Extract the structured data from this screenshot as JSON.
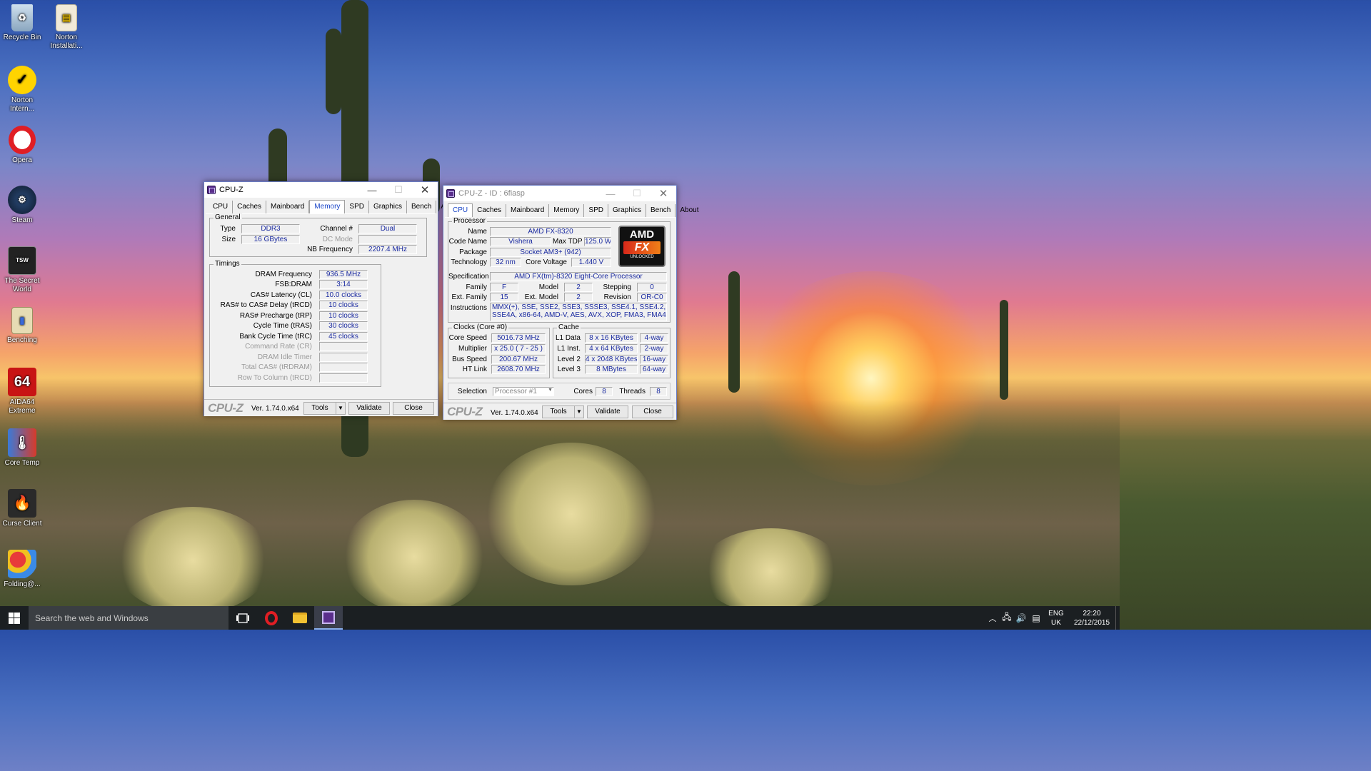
{
  "desktop": {
    "icons": [
      {
        "label": "Recycle Bin",
        "icon": "recycle-bin-icon"
      },
      {
        "label": "Norton Installati...",
        "icon": "folder-icon"
      },
      {
        "label": "Norton Intern...",
        "icon": "norton-icon"
      },
      {
        "label": "Opera",
        "icon": "opera-icon"
      },
      {
        "label": "Steam",
        "icon": "steam-icon"
      },
      {
        "label": "The Secret World",
        "icon": "secret-world-icon"
      },
      {
        "label": "Benching",
        "icon": "benching-icon"
      },
      {
        "label": "AIDA64 Extreme",
        "icon": "aida64-icon",
        "badge": "64"
      },
      {
        "label": "Core Temp",
        "icon": "core-temp-icon"
      },
      {
        "label": "Curse Client",
        "icon": "curse-client-icon"
      },
      {
        "label": "Folding@...",
        "icon": "folding-icon"
      }
    ]
  },
  "memory_window": {
    "title": "CPU-Z",
    "tabs": [
      "CPU",
      "Caches",
      "Mainboard",
      "Memory",
      "SPD",
      "Graphics",
      "Bench",
      "About"
    ],
    "selected_tab": "Memory",
    "general": {
      "group_label": "General",
      "type_label": "Type",
      "type": "DDR3",
      "size_label": "Size",
      "size": "16 GBytes",
      "channel_label": "Channel #",
      "channel": "Dual",
      "dc_mode_label": "DC Mode",
      "dc_mode": "",
      "nb_freq_label": "NB Frequency",
      "nb_freq": "2207.4 MHz"
    },
    "timings": {
      "group_label": "Timings",
      "rows": [
        {
          "label": "DRAM Frequency",
          "value": "936.5 MHz"
        },
        {
          "label": "FSB:DRAM",
          "value": "3:14"
        },
        {
          "label": "CAS# Latency (CL)",
          "value": "10.0 clocks"
        },
        {
          "label": "RAS# to CAS# Delay (tRCD)",
          "value": "10 clocks"
        },
        {
          "label": "RAS# Precharge (tRP)",
          "value": "10 clocks"
        },
        {
          "label": "Cycle Time (tRAS)",
          "value": "30 clocks"
        },
        {
          "label": "Bank Cycle Time (tRC)",
          "value": "45 clocks"
        },
        {
          "label": "Command Rate (CR)",
          "value": ""
        },
        {
          "label": "DRAM Idle Timer",
          "value": ""
        },
        {
          "label": "Total CAS# (tRDRAM)",
          "value": ""
        },
        {
          "label": "Row To Column (tRCD)",
          "value": ""
        }
      ]
    },
    "footer": {
      "brand": "CPU-Z",
      "version": "Ver. 1.74.0.x64",
      "tools": "Tools",
      "validate": "Validate",
      "close": "Close"
    }
  },
  "cpu_window": {
    "title": "CPU-Z - ID : 6fiasp",
    "tabs": [
      "CPU",
      "Caches",
      "Mainboard",
      "Memory",
      "SPD",
      "Graphics",
      "Bench",
      "About"
    ],
    "selected_tab": "CPU",
    "processor": {
      "group_label": "Processor",
      "name_label": "Name",
      "name": "AMD FX-8320",
      "codename_label": "Code Name",
      "codename": "Vishera",
      "maxtdp_label": "Max TDP",
      "maxtdp": "125.0 W",
      "package_label": "Package",
      "package": "Socket AM3+ (942)",
      "tech_label": "Technology",
      "tech": "32 nm",
      "voltage_label": "Core Voltage",
      "voltage": "1.440 V",
      "spec_label": "Specification",
      "spec": "AMD FX(tm)-8320 Eight-Core Processor",
      "family_label": "Family",
      "family": "F",
      "model_label": "Model",
      "model": "2",
      "stepping_label": "Stepping",
      "stepping": "0",
      "extfamily_label": "Ext. Family",
      "extfamily": "15",
      "extmodel_label": "Ext. Model",
      "extmodel": "2",
      "revision_label": "Revision",
      "revision": "OR-C0",
      "instr_label": "Instructions",
      "instr": "MMX(+), SSE, SSE2, SSE3, SSSE3, SSE4.1, SSE4.2, SSE4A, x86-64, AMD-V, AES, AVX, XOP, FMA3, FMA4",
      "logo_top": "AMD",
      "logo_mid": "FX",
      "logo_bottom": "UNLOCKED"
    },
    "clocks": {
      "group_label": "Clocks (Core #0)",
      "core_speed_label": "Core Speed",
      "core_speed": "5016.73 MHz",
      "multiplier_label": "Multiplier",
      "multiplier": "x 25.0 ( 7 - 25 )",
      "bus_speed_label": "Bus Speed",
      "bus_speed": "200.67 MHz",
      "ht_link_label": "HT Link",
      "ht_link": "2608.70 MHz"
    },
    "cache": {
      "group_label": "Cache",
      "rows": [
        {
          "label": "L1 Data",
          "size": "8 x 16 KBytes",
          "way": "4-way"
        },
        {
          "label": "L1 Inst.",
          "size": "4 x 64 KBytes",
          "way": "2-way"
        },
        {
          "label": "Level 2",
          "size": "4 x 2048 KBytes",
          "way": "16-way"
        },
        {
          "label": "Level 3",
          "size": "8 MBytes",
          "way": "64-way"
        }
      ]
    },
    "selection": {
      "label": "Selection",
      "value": "Processor #1",
      "cores_label": "Cores",
      "cores": "8",
      "threads_label": "Threads",
      "threads": "8"
    },
    "footer": {
      "brand": "CPU-Z",
      "version": "Ver. 1.74.0.x64",
      "tools": "Tools",
      "validate": "Validate",
      "close": "Close"
    }
  },
  "taskbar": {
    "search_placeholder": "Search the web and Windows",
    "lang": "ENG",
    "region": "UK",
    "time": "22:20",
    "date": "22/12/2015"
  }
}
